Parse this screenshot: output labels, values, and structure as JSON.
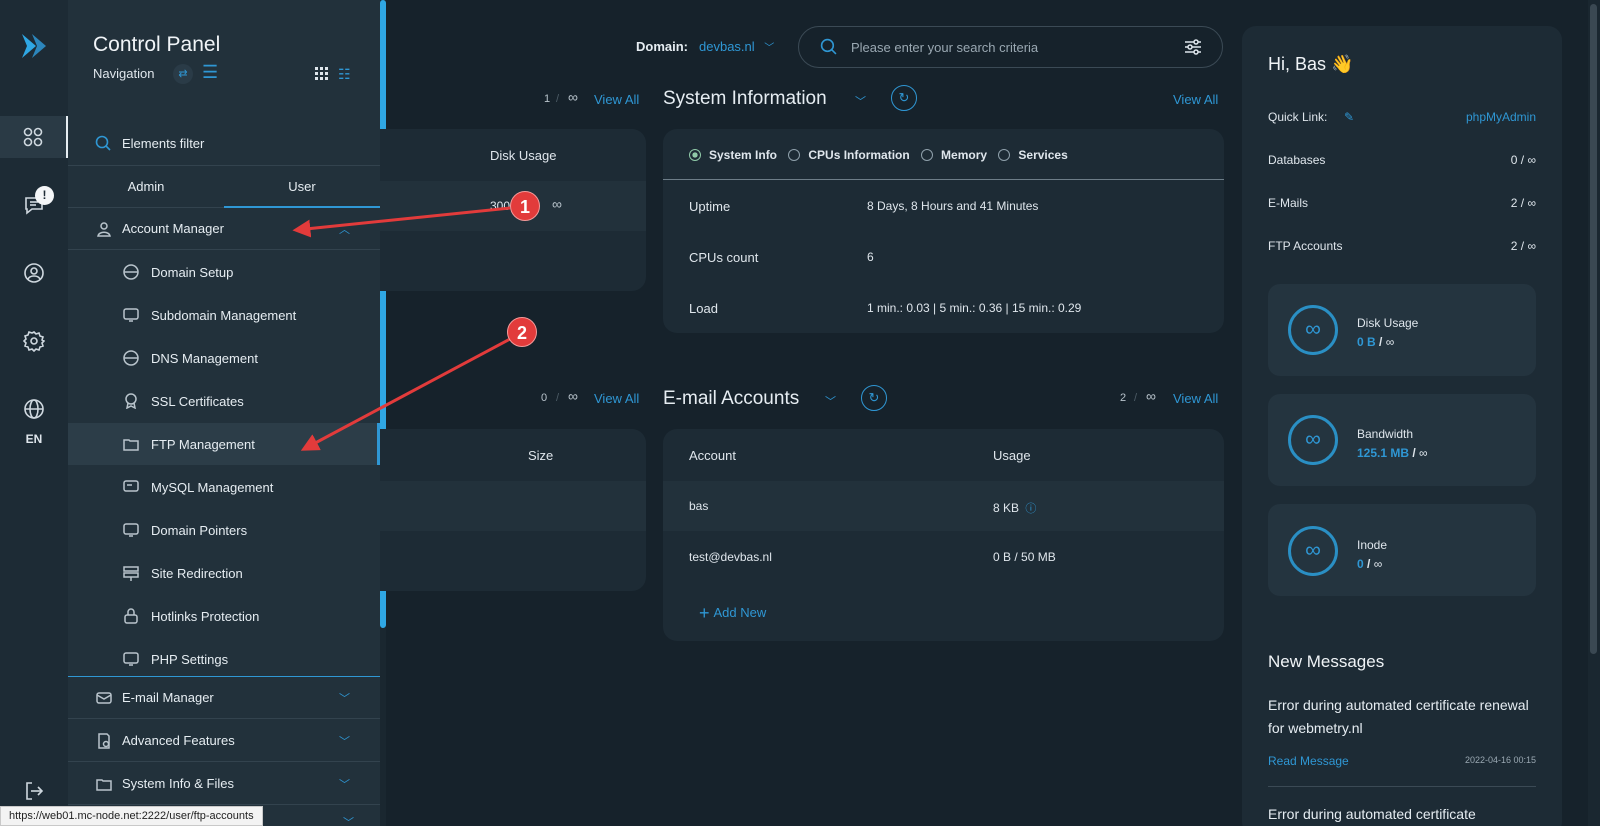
{
  "rail": {
    "language": "EN",
    "badge": "!"
  },
  "nav": {
    "title": "Control Panel",
    "subtitle": "Navigation",
    "filter_label": "Elements filter",
    "tabs": [
      "Admin",
      "User"
    ],
    "account_manager": "Account Manager",
    "items": [
      "Domain Setup",
      "Subdomain Management",
      "DNS Management",
      "SSL Certificates",
      "FTP Management",
      "MySQL Management",
      "Domain Pointers",
      "Site Redirection",
      "Hotlinks Protection",
      "PHP Settings"
    ],
    "groups": [
      "E-mail Manager",
      "Advanced Features",
      "System Info & Files"
    ]
  },
  "header": {
    "domain_label": "Domain:",
    "domain_value": "devbas.nl",
    "search_placeholder": "Please enter your search criteria"
  },
  "left_cards": {
    "count1": "1",
    "view_all1": "View All",
    "col1": "Disk Usage",
    "val1": "300",
    "count2": "0",
    "view_all2": "View All",
    "col2": "Size"
  },
  "system_info": {
    "title": "System Information",
    "view_all": "View All",
    "radios": [
      "System Info",
      "CPUs Information",
      "Memory",
      "Services"
    ],
    "rows": [
      {
        "label": "Uptime",
        "value": "8 Days, 8 Hours and 41 Minutes"
      },
      {
        "label": "CPUs count",
        "value": "6"
      },
      {
        "label": "Load",
        "value": "1 min.: 0.03 | 5 min.: 0.36 | 15 min.: 0.29"
      }
    ]
  },
  "email": {
    "title": "E-mail Accounts",
    "count": "2",
    "view_all": "View All",
    "col_account": "Account",
    "col_usage": "Usage",
    "rows": [
      {
        "account": "bas",
        "usage": "8 KB"
      },
      {
        "account": "test@devbas.nl",
        "usage": "0 B / 50 MB"
      }
    ],
    "add_new": "Add New"
  },
  "right": {
    "greeting": "Hi, Bas 👋",
    "quick_link_label": "Quick Link:",
    "quick_link_value": "phpMyAdmin",
    "stats": [
      {
        "label": "Databases",
        "value": "0 / ∞"
      },
      {
        "label": "E-Mails",
        "value": "2 / ∞"
      },
      {
        "label": "FTP Accounts",
        "value": "2 / ∞"
      }
    ],
    "resources": [
      {
        "name": "Disk Usage",
        "used": "0 B",
        "limit": "∞"
      },
      {
        "name": "Bandwidth",
        "used": "125.1 MB",
        "limit": "∞"
      },
      {
        "name": "Inode",
        "used": "0",
        "limit": "∞"
      }
    ],
    "messages_title": "New Messages",
    "message1": "Error during automated certificate renewal for webmetry.nl",
    "read_message": "Read Message",
    "message1_date": "2022-04-16 00:15",
    "message2": "Error during automated certificate"
  },
  "status_url": "https://web01.mc-node.net:2222/user/ftp-accounts",
  "annotations": [
    "1",
    "2"
  ],
  "colors": {
    "accent": "#2f97d4",
    "background": "#16222b",
    "marker": "#e23b3b"
  }
}
